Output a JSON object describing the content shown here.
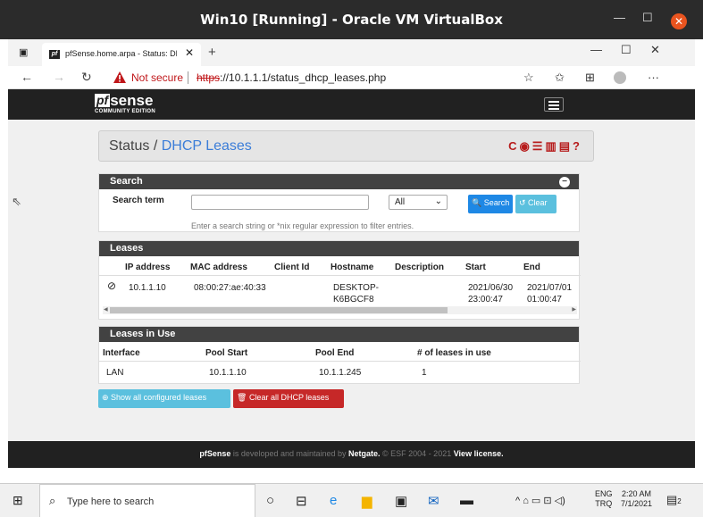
{
  "vm_title": "Win10 [Running] - Oracle VM VirtualBox",
  "browser": {
    "tab_title": "pfSense.home.arpa - Status: DHC",
    "favicon": "pf",
    "security": "Not secure",
    "url_scheme": "https",
    "url_rest": "://10.1.1.1/status_dhcp_leases.php"
  },
  "navbar": {
    "logo_pf": "pf",
    "logo_sense": "sense",
    "logo_sub": "COMMUNITY EDITION"
  },
  "breadcrumb": {
    "status": "Status",
    "sep": "/",
    "page": "DHCP Leases"
  },
  "search_panel": {
    "title": "Search",
    "term_label": "Search term",
    "term_value": "",
    "select_value": "All",
    "search_button": "Search",
    "clear_button": "Clear",
    "help": "Enter a search string or *nix regular expression to filter entries."
  },
  "leases": {
    "title": "Leases",
    "columns": [
      "IP address",
      "MAC address",
      "Client Id",
      "Hostname",
      "Description",
      "Start",
      "End"
    ],
    "rows": [
      {
        "ip": "10.1.1.10",
        "mac": "08:00:27:ae:40:33",
        "client_id": "",
        "host1": "DESKTOP-",
        "host2": "K6BGCF8",
        "description": "",
        "start1": "2021/06/30",
        "start2": "23:00:47",
        "end1": "2021/07/01",
        "end2": "01:00:47"
      }
    ]
  },
  "leases_in_use": {
    "title": "Leases in Use",
    "columns": [
      "Interface",
      "Pool Start",
      "Pool End",
      "# of leases in use"
    ],
    "rows": [
      {
        "interface": "LAN",
        "pool_start": "10.1.1.10",
        "pool_end": "10.1.1.245",
        "count": "1"
      }
    ]
  },
  "actions": {
    "show_all": "Show all configured leases",
    "clear_all": "Clear all DHCP leases"
  },
  "footer": {
    "brand": "pfSense",
    "t1": " is developed and maintained by ",
    "netgate": "Netgate.",
    "t2": " © ESF 2004 - 2021 ",
    "license": "View license."
  },
  "taskbar": {
    "search_placeholder": "Type here to search",
    "lang1": "ENG",
    "lang2": "TRQ",
    "time": "2:20 AM",
    "date": "7/1/2021",
    "notif_count": "2"
  },
  "colors": {
    "accent_red": "#b71c1c",
    "link_blue": "#3b7dd8",
    "panel_header": "#424242"
  }
}
